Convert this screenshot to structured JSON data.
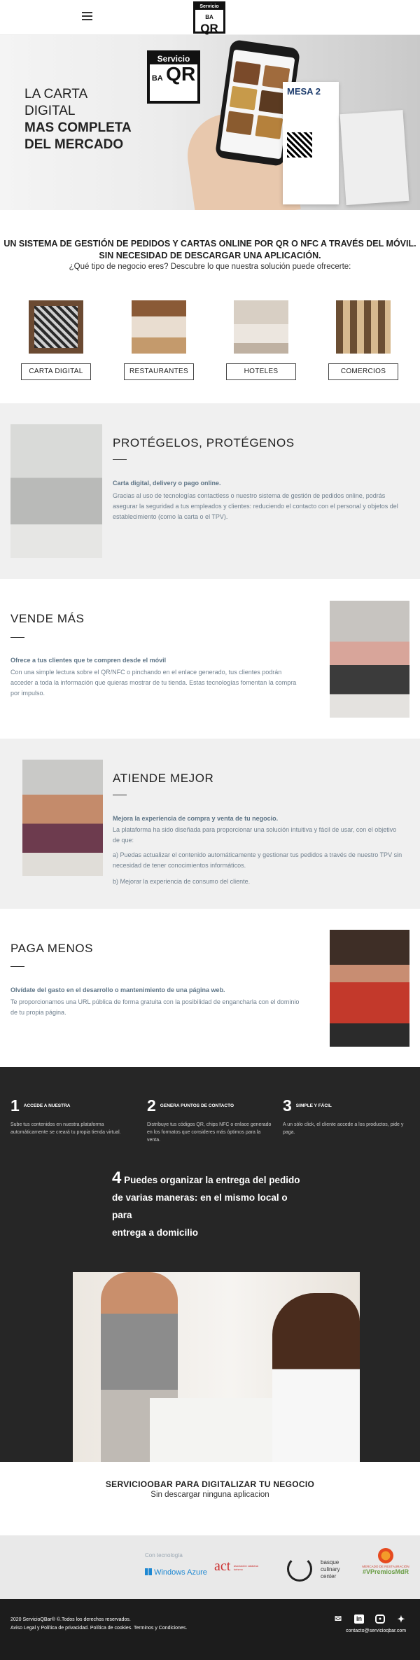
{
  "header": {
    "menu_icon": "hamburger-menu-icon",
    "logo": {
      "line1": "Servicio",
      "ba": "BA",
      "qr": "QR"
    }
  },
  "hero": {
    "line1": "LA CARTA",
    "line2": "DIGITAL",
    "line3": "MAS COMPLETA",
    "line4": "DEL MERCADO",
    "card_title": "MESA 2"
  },
  "intro": {
    "title_line1": "UN SISTEMA DE GESTIÓN DE PEDIDOS Y CARTAS ONLINE POR QR O NFC A TRAVÉS DEL MÓVIL.",
    "title_line2": "SIN NECESIDAD DE DESCARGAR UNA APLICACIÓN.",
    "question": "¿Qué tipo de negocio eres? Descubre lo que nuestra solución puede ofrecerte:"
  },
  "business_types": [
    {
      "label": "CARTA DIGITAL"
    },
    {
      "label": "RESTAURANTES"
    },
    {
      "label": "HOTELES"
    },
    {
      "label": "COMERCIOS"
    }
  ],
  "sections": {
    "protegelos": {
      "title": "PROTÉGELOS, PROTÉGENOS",
      "lead": "Carta digital, delivery o pago online.",
      "body": "Gracias al uso de tecnologías contactless o nuestro sistema de gestión de pedidos online, podrás asegurar la seguridad a tus empleados y clientes: reduciendo el contacto con el personal y objetos del establecimiento (como la carta o el TPV)."
    },
    "vende": {
      "title": "VENDE MÁS",
      "lead": "Ofrece a tus clientes que te compren desde el móvil",
      "body": "Con una simple lectura sobre el QR/NFC o pinchando en el enlace generado, tus clientes podrán acceder a toda la información que quieras mostrar de tu tienda. Estas tecnologías fomentan la compra por impulso."
    },
    "atiende": {
      "title": "ATIENDE MEJOR",
      "lead": "Mejora la experiencia de compra y venta de tu negocio.",
      "body1": "La plataforma ha sido diseñada para proporcionar una solución intuitiva y fácil de usar, con el objetivo de que:",
      "body2": "a) Puedas actualizar el contenido automáticamente y gestionar tus pedidos a través de nuestro TPV sin necesidad de tener conocimientos informáticos.",
      "body3": "b) Mejorar la experiencia de consumo del cliente."
    },
    "paga": {
      "title": "PAGA MENOS",
      "lead": "Olvídate del gasto en el desarrollo o mantenimiento de una página web.",
      "body": "Te proporcionamos una URL pública de forma gratuita con la posibilidad de engancharla con el dominio de tu propia página."
    }
  },
  "steps": [
    {
      "num": "1",
      "caption": "ACCEDE A NUESTRA",
      "desc": "Sube tus contenidos en nuestra plataforma automáticamente se creará tu propia tienda virtual."
    },
    {
      "num": "2",
      "caption": "GENERA PUNTOS DE CONTACTO",
      "desc": "Distribuye tus códigos QR, chips NFC o enlace generado en los formatos que consideres más óptimos para la venta."
    },
    {
      "num": "3",
      "caption": "SIMPLE Y FÁCIL",
      "desc": "A un sólo click, el cliente accede a los productos, pide y paga."
    }
  ],
  "step4": {
    "num": "4",
    "text1": "Puedes organizar la entrega del pedido",
    "text2": "de varias maneras: en el mismo local o para",
    "text3": "entrega a domicilio"
  },
  "cta": {
    "title": "SERVICIOOBAR PARA DIGITALIZAR TU NEGOCIO",
    "subtitle": "Sin descargar ninguna aplicacion"
  },
  "partners": {
    "label": "Con tecnología",
    "items": [
      {
        "name": "Windows Azure"
      },
      {
        "name": "act",
        "sub": "asociación catalana turismo"
      },
      {
        "name": "basque culinary center"
      },
      {
        "name": "#VPremiosMdR",
        "sub": "MERCADO DE RESTAURACIÓN"
      }
    ]
  },
  "footer": {
    "copyright": "2020 ServicioQBar® ©.Todos los derechos reservados.",
    "legal": "Aviso Legal y Política de privacidad. Política de cookies. Terminos y Condiciones.",
    "email": "contacto@servicioqbar.com",
    "social": [
      "email-icon",
      "linkedin-icon",
      "instagram-icon",
      "twitter-icon"
    ]
  },
  "colors": {
    "dark_bg": "#262626",
    "footer_bg": "#1c1c1c",
    "section_grey": "#f0f0f0",
    "muted_text": "#6f7f8d",
    "accent_blue": "#5d7486"
  }
}
